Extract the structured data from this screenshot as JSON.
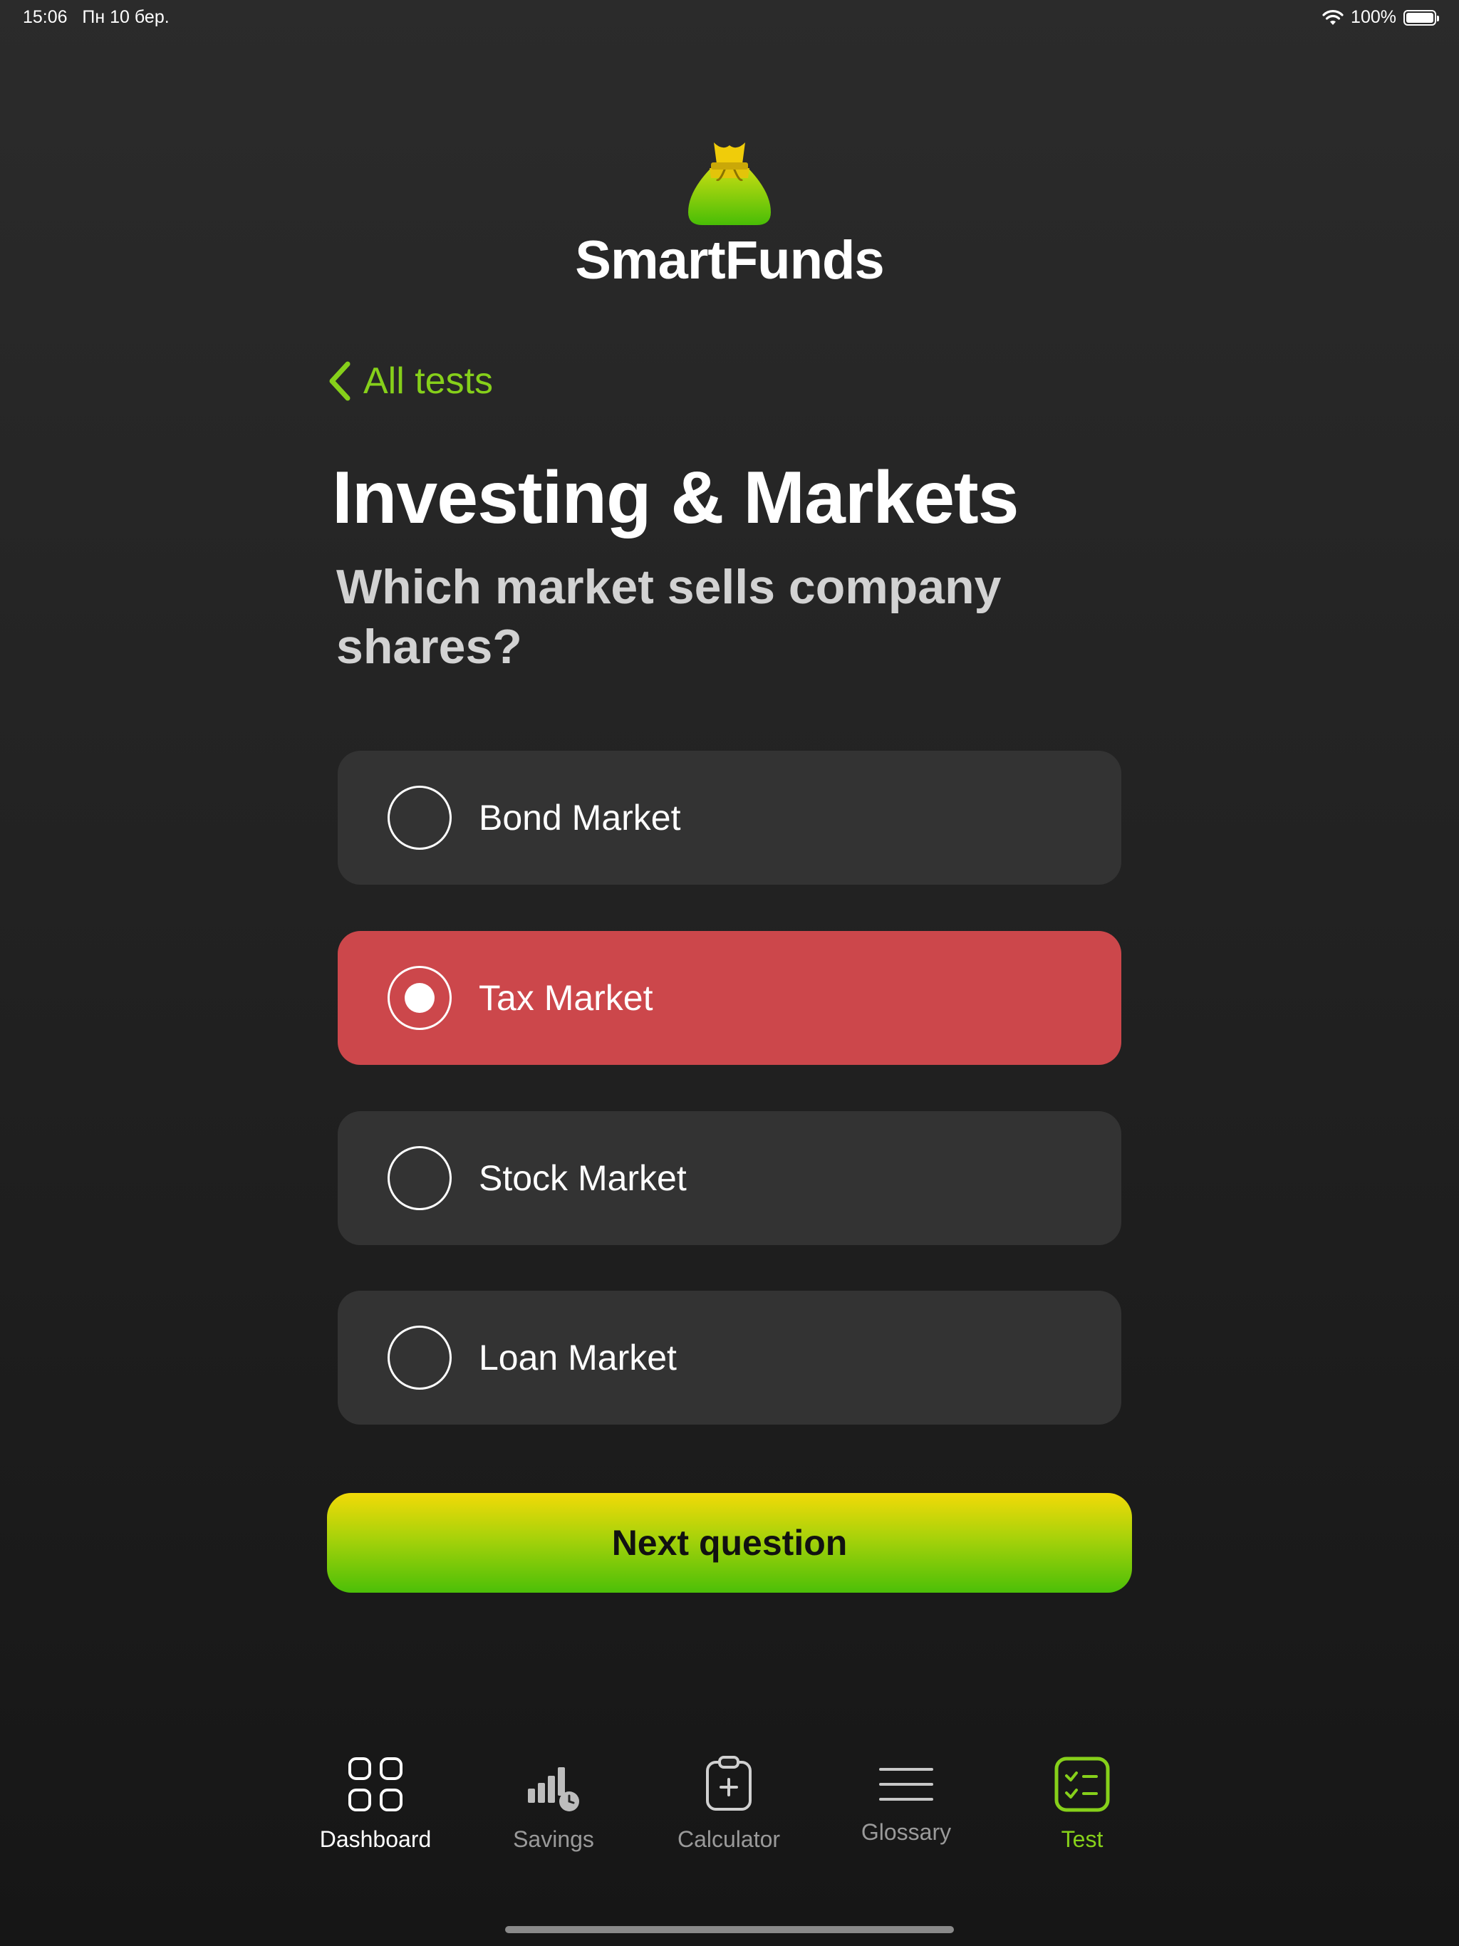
{
  "status_bar": {
    "time": "15:06",
    "date": "Пн 10 бер.",
    "battery": "100%",
    "battery_level": 1.0
  },
  "app": {
    "name": "SmartFunds"
  },
  "nav": {
    "back_label": "All tests"
  },
  "quiz": {
    "title": "Investing & Markets",
    "question": "Which market sells company shares?",
    "options": [
      {
        "label": "Bond Market",
        "selected": false,
        "state": "default"
      },
      {
        "label": "Tax Market",
        "selected": true,
        "state": "wrong"
      },
      {
        "label": "Stock Market",
        "selected": false,
        "state": "default"
      },
      {
        "label": "Loan Market",
        "selected": false,
        "state": "default"
      }
    ],
    "next_label": "Next question"
  },
  "tabs": [
    {
      "label": "Dashboard",
      "icon": "grid-icon"
    },
    {
      "label": "Savings",
      "icon": "bar-chart-clock-icon"
    },
    {
      "label": "Calculator",
      "icon": "clipboard-plus-icon"
    },
    {
      "label": "Glossary",
      "icon": "menu-lines-icon"
    },
    {
      "label": "Test",
      "icon": "checklist-icon",
      "active": true
    }
  ],
  "colors": {
    "accent_green": "#86d01a",
    "wrong_red": "#cc474b",
    "option_bg": "#333333"
  }
}
